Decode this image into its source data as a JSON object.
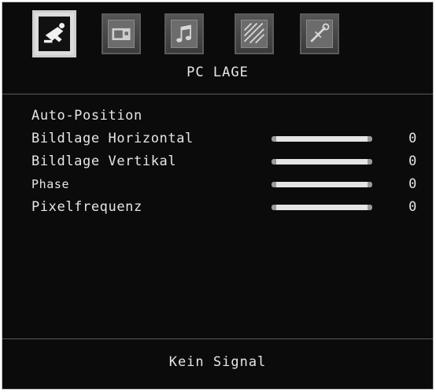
{
  "menu": {
    "title": "PC LAGE",
    "tabs": [
      {
        "icon": "satellite-dish-icon",
        "active": true
      },
      {
        "icon": "picture-icon",
        "active": false
      },
      {
        "icon": "music-note-icon",
        "active": false
      },
      {
        "icon": "feature-icon",
        "active": false
      },
      {
        "icon": "setup-icon",
        "active": false
      }
    ],
    "items": [
      {
        "label": "Auto-Position",
        "has_slider": false
      },
      {
        "label": "Bildlage Horizontal",
        "has_slider": true,
        "value": "0",
        "level": 1.0
      },
      {
        "label": "Bildlage Vertikal",
        "has_slider": true,
        "value": "0",
        "level": 1.0
      },
      {
        "label": "Phase",
        "has_slider": true,
        "value": "0",
        "level": 1.0
      },
      {
        "label": "Pixelfrequenz",
        "has_slider": true,
        "value": "0",
        "level": 1.0
      }
    ]
  },
  "status": {
    "text": "Kein Signal"
  },
  "colors": {
    "background": "#0b0b0b",
    "text": "#e6e6e6",
    "slider_fill": "#e4e4e4"
  }
}
